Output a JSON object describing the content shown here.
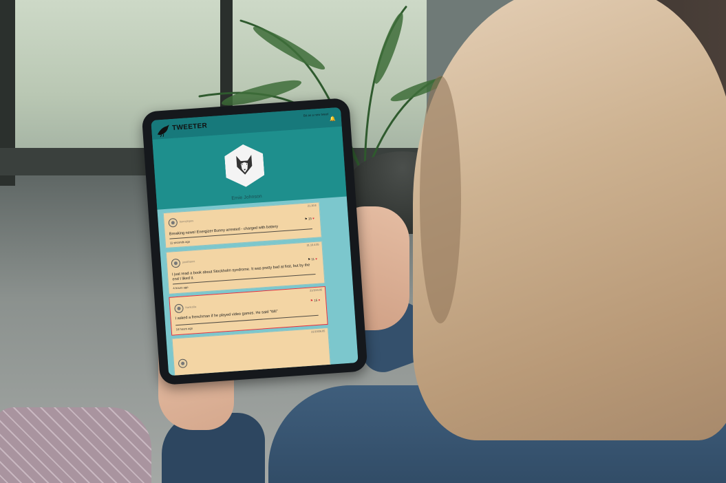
{
  "app": {
    "title": "TWEETER",
    "top_link": "Bit as a new tweet",
    "top_icon": "bell-icon"
  },
  "profile": {
    "name": "Emie Johnson",
    "avatar": "husky-icon"
  },
  "feed": {
    "tweets": [
      {
        "date": "21.10.8",
        "username": "bunnylopes",
        "text": "Breaking news! Energizer Bunny arrested - charged with battery",
        "time": "11 seconds ago",
        "likes": "15",
        "flagged": false
      },
      {
        "date": "21.10.4.05",
        "username": "jonathanni",
        "text": "I just read a book about Stockholm syndrome. It was pretty bad at first, but by the end I liked it.",
        "time": "4 hours ago",
        "likes": "11",
        "flagged": false
      },
      {
        "date": "21/10/4.05",
        "username": "frankzilla",
        "text": "I asked a frenchman if he played video games. He said \"Wii\"",
        "time": "18 hours ago",
        "likes": "15",
        "flagged": true
      },
      {
        "date": "21/10/26.05",
        "username": "",
        "text": "",
        "time": "",
        "likes": "",
        "flagged": false
      }
    ]
  },
  "colors": {
    "screen_teal": "#1e8f8d",
    "topbar_teal": "#17797b",
    "feed_bg": "#7cc7cd",
    "card_bg": "#f3d5a4",
    "flag_red": "#e02f40"
  }
}
